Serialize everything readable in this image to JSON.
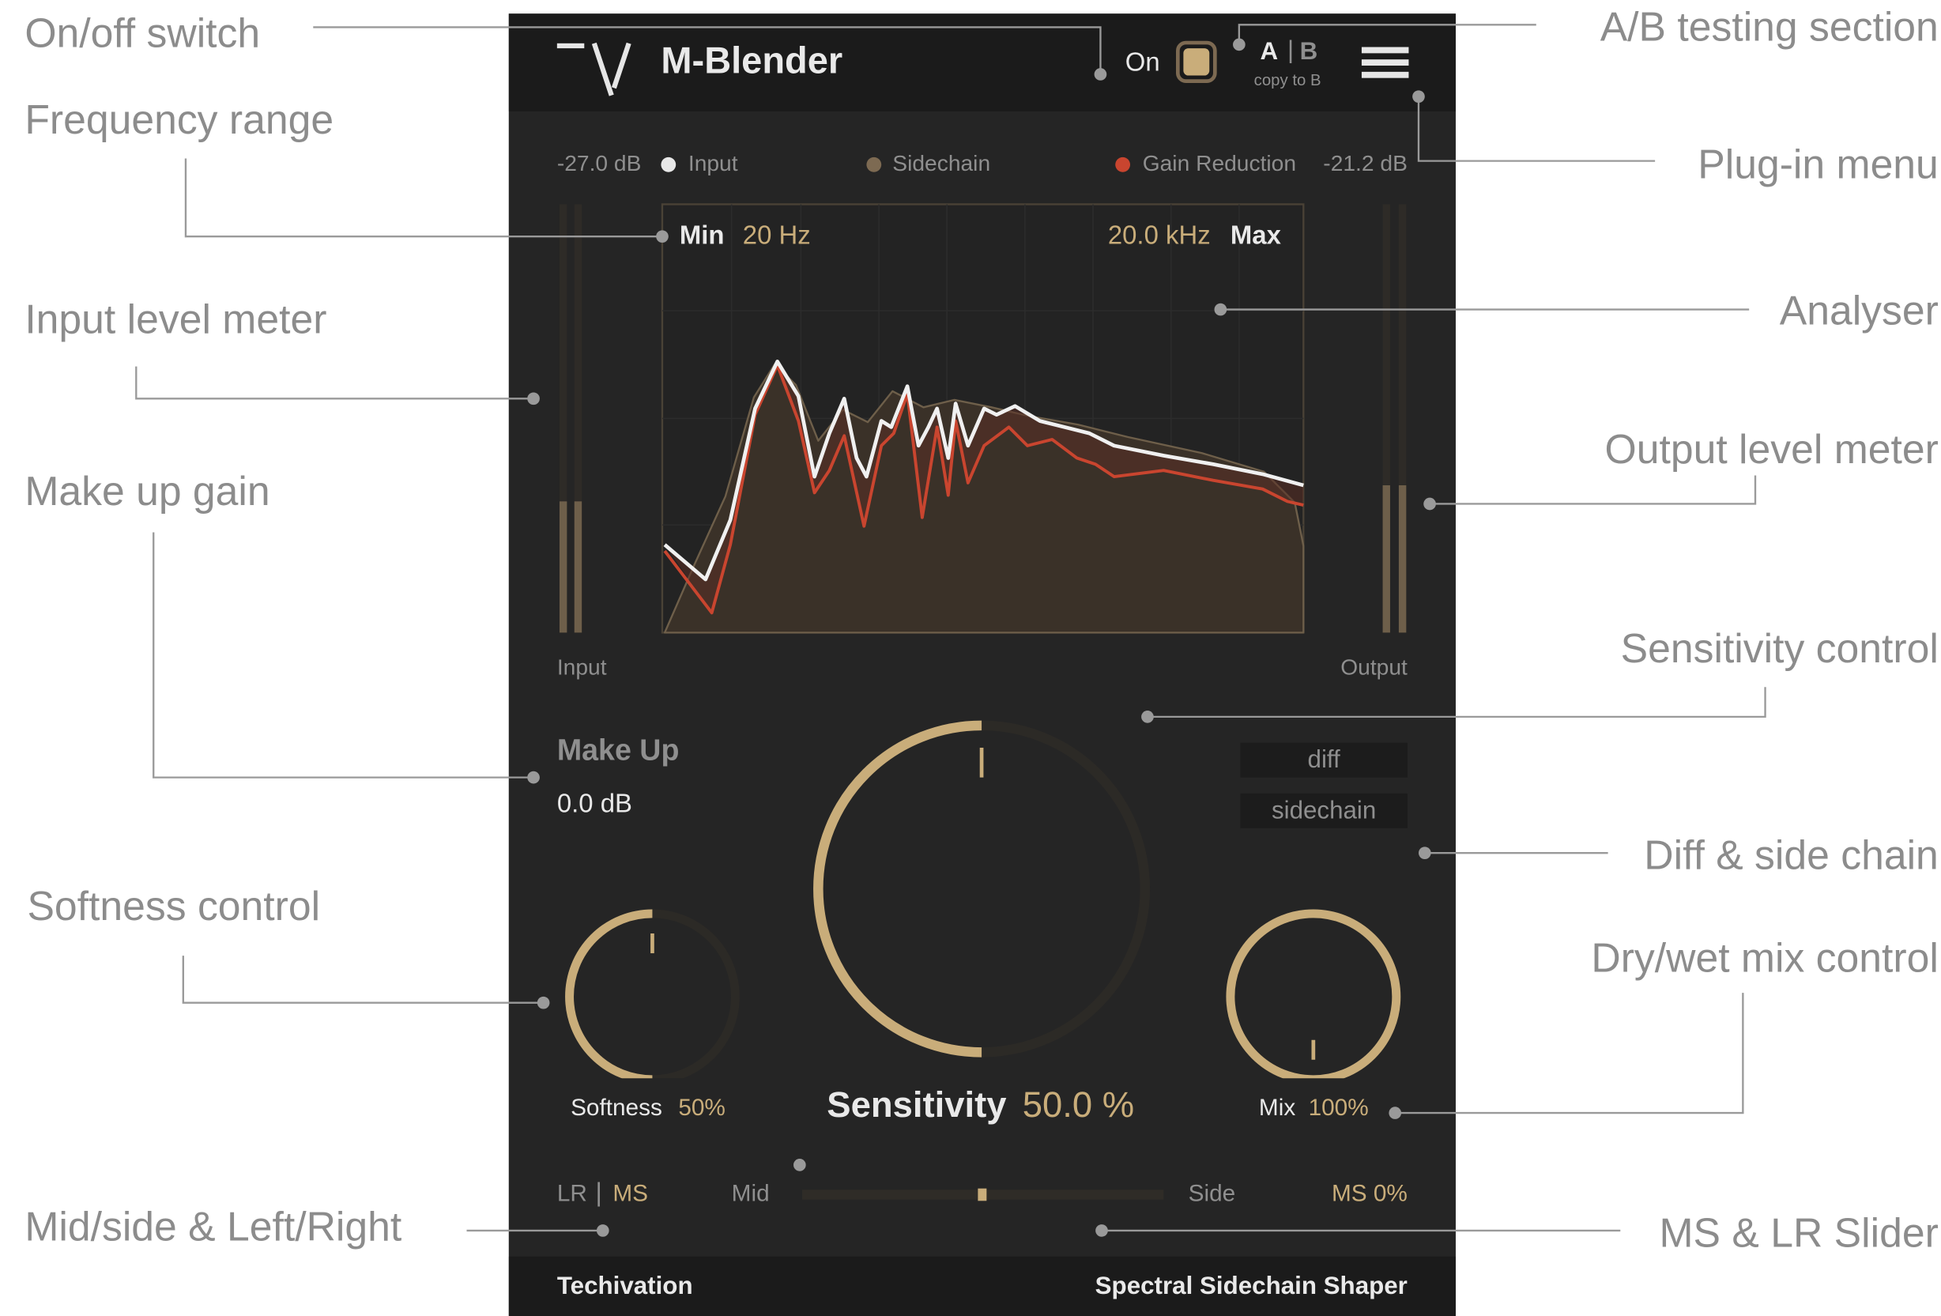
{
  "annotations": {
    "on_off": "On/off switch",
    "frequency_range": "Frequency range",
    "input_meter": "Input level meter",
    "make_up": "Make up gain",
    "softness": "Softness control",
    "mid_side": "Mid/side & Left/Right",
    "ab": "A/B testing section",
    "plugin_menu": "Plug-in menu",
    "analyser": "Analyser",
    "output_meter": "Output level meter",
    "sensitivity": "Sensitivity control",
    "diff_sidechain": "Diff & side chain",
    "dry_wet": "Dry/wet mix control",
    "ms_lr_slider": "MS & LR Slider"
  },
  "header": {
    "title": "M-Blender",
    "on_label": "On",
    "power_on": true,
    "a_label": "A",
    "b_label": "B",
    "copy_label": "copy to B",
    "menu_icon": "hamburger-icon"
  },
  "legend": {
    "input_db": "-27.0 dB",
    "input": "Input",
    "sidechain": "Sidechain",
    "gain_reduction": "Gain Reduction",
    "output_db": "-21.2 dB",
    "colors": {
      "input": "#e8e8e8",
      "sidechain": "#7d6a52",
      "gain_reduction": "#c9452f"
    }
  },
  "analyser": {
    "min_label": "Min",
    "min_value": "20 Hz",
    "max_value": "20.0 kHz",
    "max_label": "Max"
  },
  "meters": {
    "input_label": "Input",
    "output_label": "Output",
    "input_level": 0.31,
    "output_level": 0.35
  },
  "makeup": {
    "label": "Make Up",
    "value": "0.0 dB"
  },
  "modes": {
    "diff": "diff",
    "sidechain": "sidechain"
  },
  "knobs": {
    "softness": {
      "label": "Softness",
      "value": "50%",
      "fraction": 0.5
    },
    "sensitivity": {
      "label": "Sensitivity",
      "value": "50.0 %",
      "fraction": 0.5
    },
    "mix": {
      "label": "Mix",
      "value": "100%",
      "fraction": 1.0
    }
  },
  "stereo": {
    "lr": "LR",
    "sep": "|",
    "ms": "MS",
    "mid": "Mid",
    "side": "Side",
    "value": "MS 0%",
    "slider_position": 0.5
  },
  "footer": {
    "brand": "Techivation",
    "product": "Spectral Sidechain Shaper"
  },
  "accent": "#c9ad7a"
}
